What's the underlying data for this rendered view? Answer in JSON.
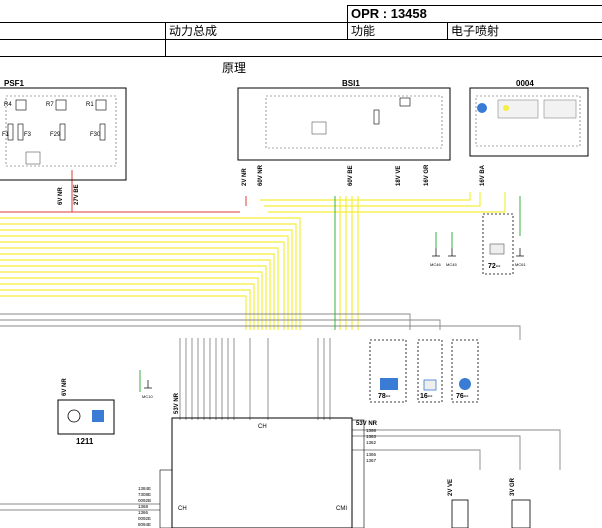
{
  "header": {
    "opr": "OPR : 13458",
    "system": "动力总成",
    "function_label": "功能",
    "function_value": "电子喷射"
  },
  "title": "原理",
  "components": [
    {
      "id": "psf1",
      "label": "PSF1"
    },
    {
      "id": "bsi1",
      "label": "BSI1"
    },
    {
      "id": "c0004",
      "label": "0004"
    },
    {
      "id": "c1211",
      "label": "1211"
    },
    {
      "id": "c78",
      "label": "78--"
    },
    {
      "id": "c16",
      "label": "16--"
    },
    {
      "id": "c76",
      "label": "76--"
    },
    {
      "id": "c72",
      "label": "72--"
    },
    {
      "id": "ch_left",
      "label": "CH"
    },
    {
      "id": "ch_top",
      "label": "CH"
    },
    {
      "id": "cmi",
      "label": "CMI"
    }
  ],
  "psf1_fuses": [
    "F1",
    "F3",
    "F29",
    "F30"
  ],
  "psf1_relays": [
    "R4",
    "R7",
    "R1"
  ],
  "connector_labels": {
    "psf1_6v_nr": "6V NR",
    "psf1_27v_be": "27V BE",
    "bsi_2v_nr": "2V NR",
    "bsi_60v_nr": "60V NR",
    "bsi_60v_be": "60V BE",
    "bsi_18v_ve": "18V VE",
    "bsi_16v_gr": "16V GR",
    "c0004_16v_ba": "16V BA",
    "c1211_6v_nr": "6V NR",
    "ch_53v_nr": "53V NR",
    "cmi_53v_nr": "53V NR",
    "bottom_2v_ve": "2V VE",
    "bottom_3v_gr": "3V GR"
  },
  "ground_labels": {
    "mc10": "MC10",
    "mc46": "MC46",
    "mc45": "MC45",
    "mc61": "MC61"
  },
  "cmi_wires": [
    "1368",
    "1363",
    "1362",
    "1366",
    "1367"
  ],
  "ch_wires": [
    "1384E",
    "7308E",
    "0092B",
    "1368",
    "1366",
    "0092E",
    "8094E"
  ]
}
